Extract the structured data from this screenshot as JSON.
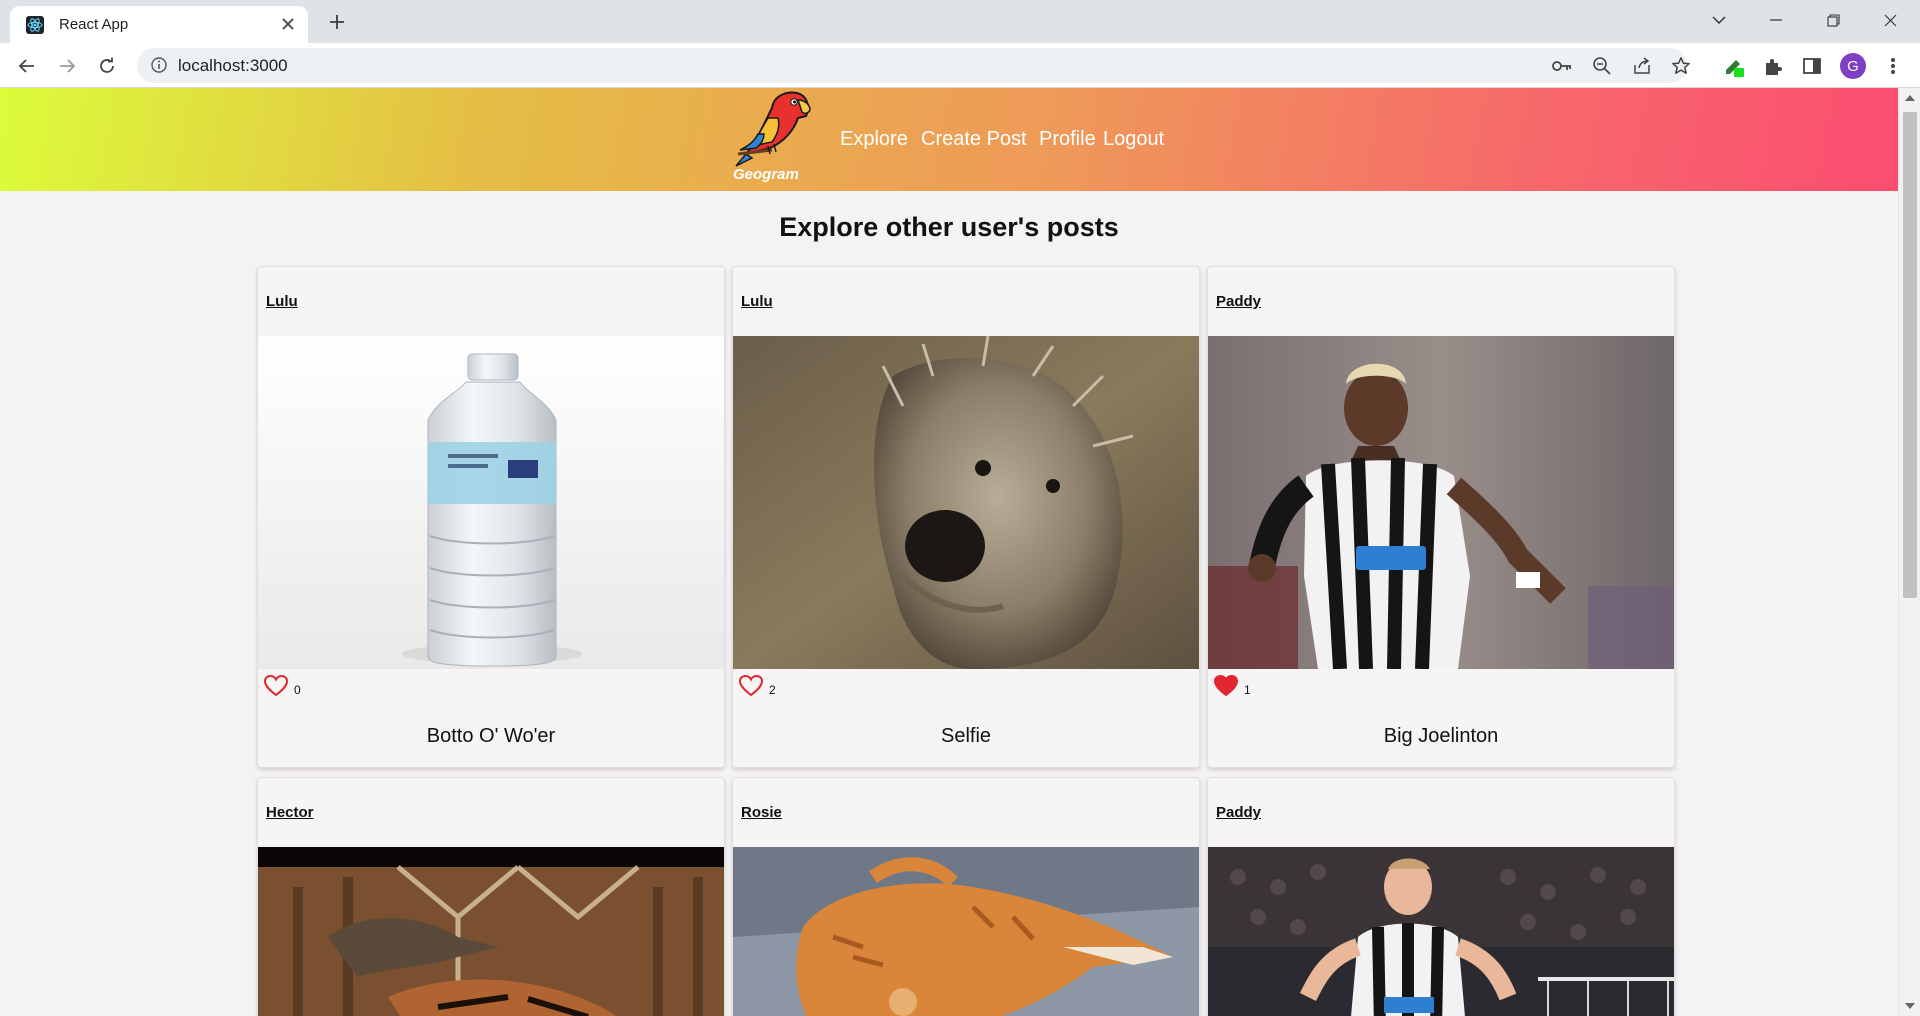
{
  "browser": {
    "tab_title": "React App",
    "url": "localhost:3000",
    "profile_initial": "G",
    "icons": [
      "react-favicon",
      "close-icon",
      "plus-icon",
      "chevron-down-icon",
      "minimize-icon",
      "restore-icon",
      "window-close-icon",
      "back-arrow-icon",
      "forward-arrow-icon",
      "reload-icon",
      "info-icon",
      "key-icon",
      "zoom-out-icon",
      "share-icon",
      "star-icon",
      "extension-pencil-icon",
      "puzzle-icon",
      "side-panel-icon",
      "kebab-menu-icon"
    ]
  },
  "app": {
    "logo_text": "Geogram",
    "nav": {
      "explore": "Explore",
      "create_post": "Create Post",
      "profile": "Profile",
      "logout": "Logout"
    },
    "page_title": "Explore other user's posts",
    "colors": {
      "header_gradient_start": "#dcfc3a",
      "header_gradient_end": "#fb4d71",
      "like_red": "#e0262e"
    }
  },
  "posts": [
    {
      "user": "Lulu",
      "likes": "0",
      "liked": false,
      "caption": "Botto O' Wo'er",
      "image": "water-bottle-photo"
    },
    {
      "user": "Lulu",
      "likes": "2",
      "liked": false,
      "caption": "Selfie",
      "image": "scruffy-dog-photo"
    },
    {
      "user": "Paddy",
      "likes": "1",
      "liked": true,
      "caption": "Big Joelinton",
      "image": "footballer-running-photo"
    },
    {
      "user": "Hector",
      "image": "dinosaur-museum-photo"
    },
    {
      "user": "Rosie",
      "image": "ginger-cat-photo"
    },
    {
      "user": "Paddy",
      "image": "footballer-celebrating-photo"
    }
  ]
}
